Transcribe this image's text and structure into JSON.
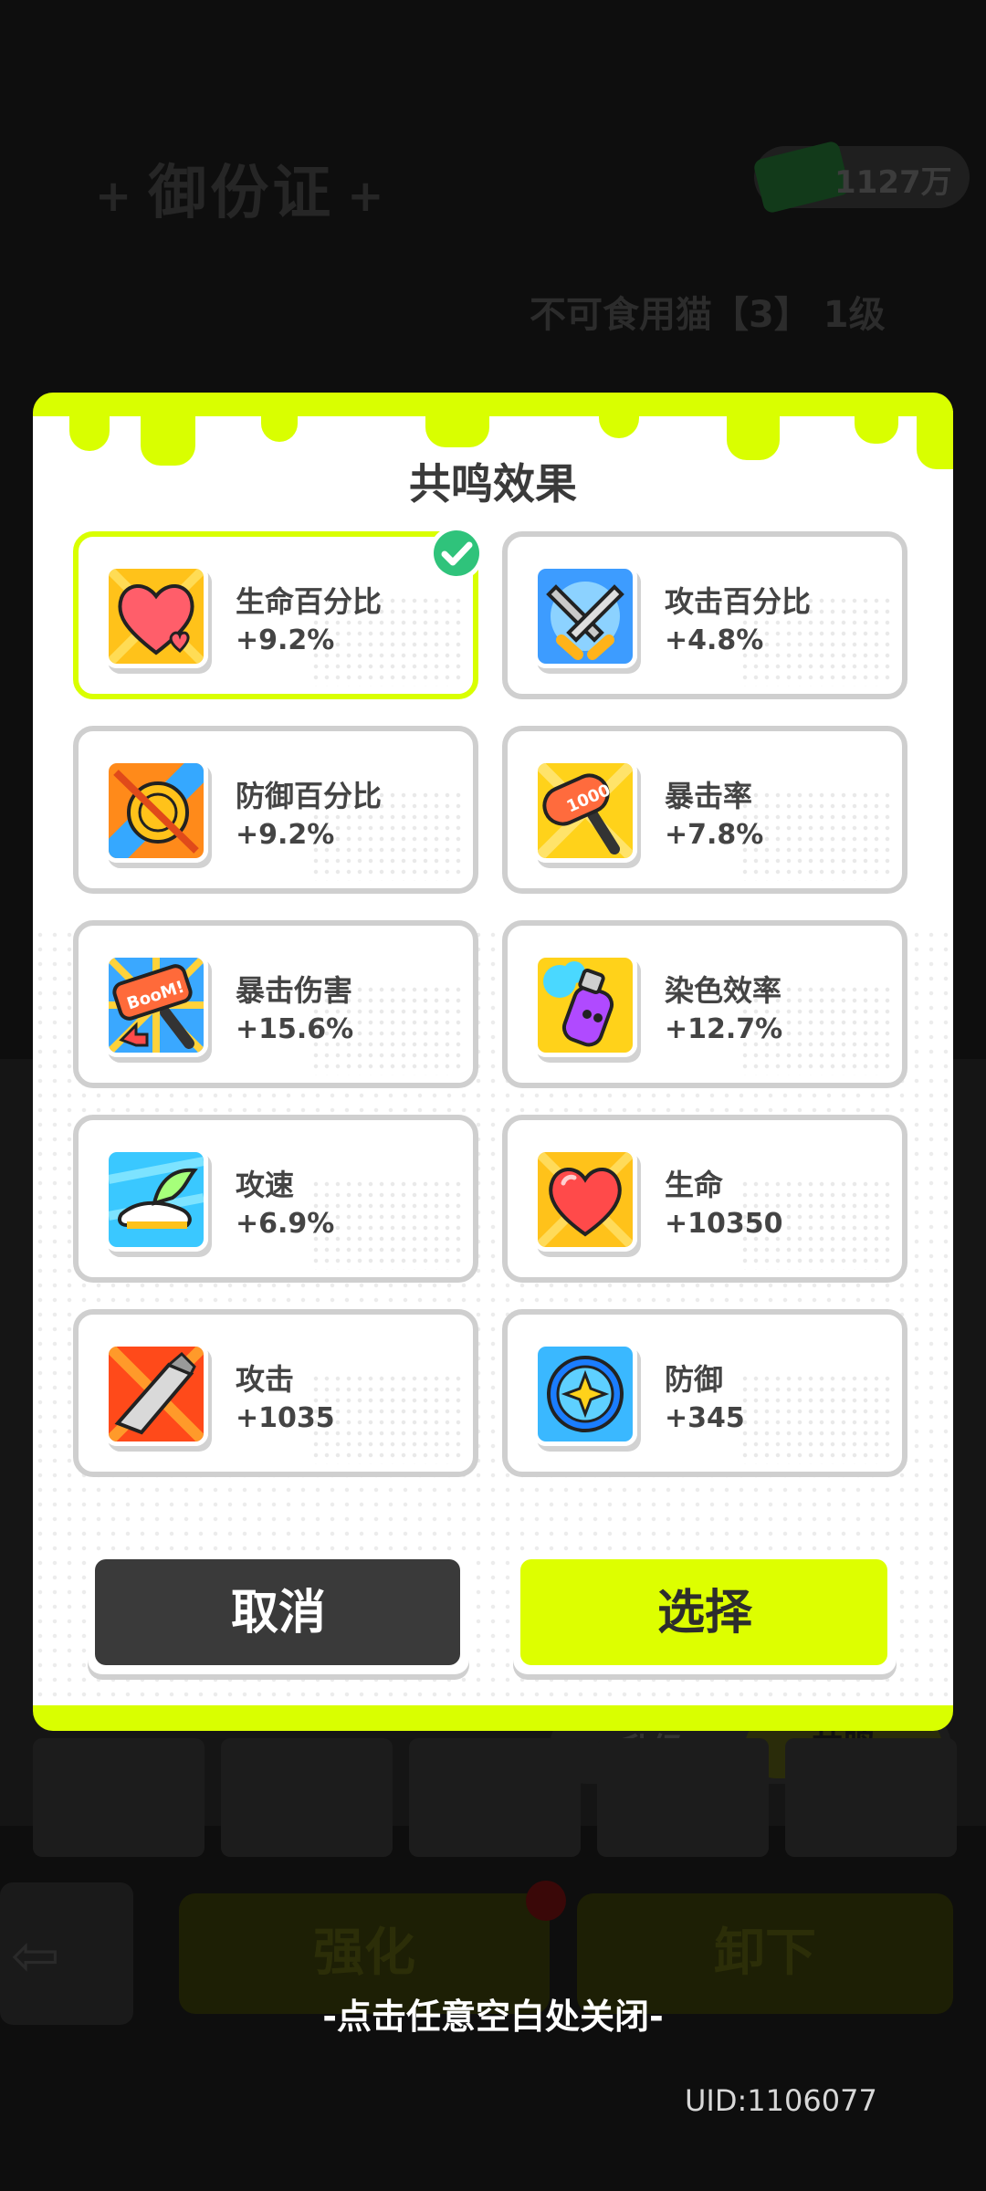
{
  "background": {
    "title": "御份证",
    "currency": "1127万",
    "subtitle": "不可食用猫【3】 1级",
    "tab_upgrade": "升级",
    "tab_resonance": "共鸣",
    "btn_strengthen": "强化",
    "btn_unequip": "卸下"
  },
  "modal": {
    "title": "共鸣效果",
    "effects": [
      {
        "name": "生命百分比",
        "value": "+9.2%",
        "icon": "heart-percent-icon",
        "selected": true
      },
      {
        "name": "攻击百分比",
        "value": "+4.8%",
        "icon": "crossed-swords-icon",
        "selected": false
      },
      {
        "name": "防御百分比",
        "value": "+9.2%",
        "icon": "broken-shield-icon",
        "selected": false
      },
      {
        "name": "暴击率",
        "value": "+7.8%",
        "icon": "hammer-icon",
        "selected": false
      },
      {
        "name": "暴击伤害",
        "value": "+15.6%",
        "icon": "boom-hammer-icon",
        "selected": false
      },
      {
        "name": "染色效率",
        "value": "+12.7%",
        "icon": "paint-spray-icon",
        "selected": false
      },
      {
        "name": "攻速",
        "value": "+6.9%",
        "icon": "winged-shoe-icon",
        "selected": false
      },
      {
        "name": "生命",
        "value": "+10350",
        "icon": "heart-icon",
        "selected": false
      },
      {
        "name": "攻击",
        "value": "+1035",
        "icon": "blade-icon",
        "selected": false
      },
      {
        "name": "防御",
        "value": "+345",
        "icon": "shield-star-icon",
        "selected": false
      }
    ],
    "cancel_label": "取消",
    "select_label": "选择"
  },
  "close_hint": "-点击任意空白处关闭-",
  "uid": "UID:1106077",
  "colors": {
    "accent": "#d9ff00",
    "card_border": "#cfcfcf",
    "dark_button": "#3a3a3a"
  }
}
